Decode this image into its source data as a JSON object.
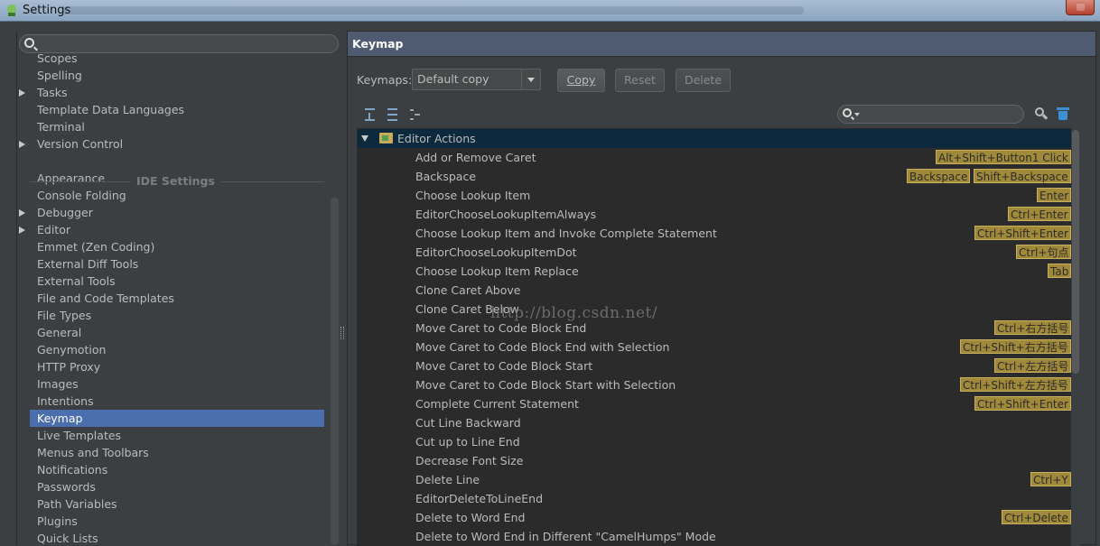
{
  "window": {
    "title": "Settings"
  },
  "left_panel": {
    "search_placeholder": "",
    "section_header": "IDE Settings",
    "items": [
      {
        "label": "Scopes",
        "arrow": false,
        "selected": false
      },
      {
        "label": "Spelling",
        "arrow": false,
        "selected": false
      },
      {
        "label": "Tasks",
        "arrow": true,
        "selected": false
      },
      {
        "label": "Template Data Languages",
        "arrow": false,
        "selected": false
      },
      {
        "label": "Terminal",
        "arrow": false,
        "selected": false
      },
      {
        "label": "Version Control",
        "arrow": true,
        "selected": false
      },
      {
        "label": "Appearance",
        "arrow": false,
        "selected": false
      },
      {
        "label": "Console Folding",
        "arrow": false,
        "selected": false
      },
      {
        "label": "Debugger",
        "arrow": true,
        "selected": false
      },
      {
        "label": "Editor",
        "arrow": true,
        "selected": false
      },
      {
        "label": "Emmet (Zen Coding)",
        "arrow": false,
        "selected": false
      },
      {
        "label": "External Diff Tools",
        "arrow": false,
        "selected": false
      },
      {
        "label": "External Tools",
        "arrow": false,
        "selected": false
      },
      {
        "label": "File and Code Templates",
        "arrow": false,
        "selected": false
      },
      {
        "label": "File Types",
        "arrow": false,
        "selected": false
      },
      {
        "label": "General",
        "arrow": false,
        "selected": false
      },
      {
        "label": "Genymotion",
        "arrow": false,
        "selected": false
      },
      {
        "label": "HTTP Proxy",
        "arrow": false,
        "selected": false
      },
      {
        "label": "Images",
        "arrow": false,
        "selected": false
      },
      {
        "label": "Intentions",
        "arrow": false,
        "selected": false
      },
      {
        "label": "Keymap",
        "arrow": false,
        "selected": true
      },
      {
        "label": "Live Templates",
        "arrow": false,
        "selected": false
      },
      {
        "label": "Menus and Toolbars",
        "arrow": false,
        "selected": false
      },
      {
        "label": "Notifications",
        "arrow": false,
        "selected": false
      },
      {
        "label": "Passwords",
        "arrow": false,
        "selected": false
      },
      {
        "label": "Path Variables",
        "arrow": false,
        "selected": false
      },
      {
        "label": "Plugins",
        "arrow": false,
        "selected": false
      },
      {
        "label": "Quick Lists",
        "arrow": false,
        "selected": false
      }
    ]
  },
  "right_panel": {
    "header": "Keymap",
    "keymaps_label": "Keymaps:",
    "keymap_selected": "Default copy",
    "buttons": {
      "copy": "Copy",
      "reset": "Reset",
      "delete": "Delete"
    },
    "toolbar_icons": [
      "expand-all-icon",
      "collapse-all-icon",
      "filter-icon"
    ],
    "filter_placeholder": "",
    "group": "Editor Actions",
    "watermark": "http://blog.csdn.net/",
    "actions": [
      {
        "name": "Add or Remove Caret",
        "shortcuts": [
          "Alt+Shift+Button1 Click"
        ]
      },
      {
        "name": "Backspace",
        "shortcuts": [
          "Backspace",
          "Shift+Backspace"
        ]
      },
      {
        "name": "Choose Lookup Item",
        "shortcuts": [
          "Enter"
        ]
      },
      {
        "name": "EditorChooseLookupItemAlways",
        "shortcuts": [
          "Ctrl+Enter"
        ]
      },
      {
        "name": "Choose Lookup Item and Invoke Complete Statement",
        "shortcuts": [
          "Ctrl+Shift+Enter"
        ]
      },
      {
        "name": "EditorChooseLookupItemDot",
        "shortcuts": [
          "Ctrl+句点"
        ]
      },
      {
        "name": "Choose Lookup Item Replace",
        "shortcuts": [
          "Tab"
        ]
      },
      {
        "name": "Clone Caret Above",
        "shortcuts": []
      },
      {
        "name": "Clone Caret Below",
        "shortcuts": []
      },
      {
        "name": "Move Caret to Code Block End",
        "shortcuts": [
          "Ctrl+右方括号"
        ]
      },
      {
        "name": "Move Caret to Code Block End with Selection",
        "shortcuts": [
          "Ctrl+Shift+右方括号"
        ]
      },
      {
        "name": "Move Caret to Code Block Start",
        "shortcuts": [
          "Ctrl+左方括号"
        ]
      },
      {
        "name": "Move Caret to Code Block Start with Selection",
        "shortcuts": [
          "Ctrl+Shift+左方括号"
        ]
      },
      {
        "name": "Complete Current Statement",
        "shortcuts": [
          "Ctrl+Shift+Enter"
        ]
      },
      {
        "name": "Cut Line Backward",
        "shortcuts": []
      },
      {
        "name": "Cut up to Line End",
        "shortcuts": []
      },
      {
        "name": "Decrease Font Size",
        "shortcuts": []
      },
      {
        "name": "Delete Line",
        "shortcuts": [
          "Ctrl+Y"
        ]
      },
      {
        "name": "EditorDeleteToLineEnd",
        "shortcuts": []
      },
      {
        "name": "Delete to Word End",
        "shortcuts": [
          "Ctrl+Delete"
        ]
      },
      {
        "name": "Delete to Word End in Different \"CamelHumps\" Mode",
        "shortcuts": []
      }
    ]
  },
  "colors": {
    "selection": "#4b6eaf",
    "shortcut_bg": "#a08a3a",
    "panel_bg": "#3c3f41",
    "list_bg": "#2b2b2b"
  }
}
